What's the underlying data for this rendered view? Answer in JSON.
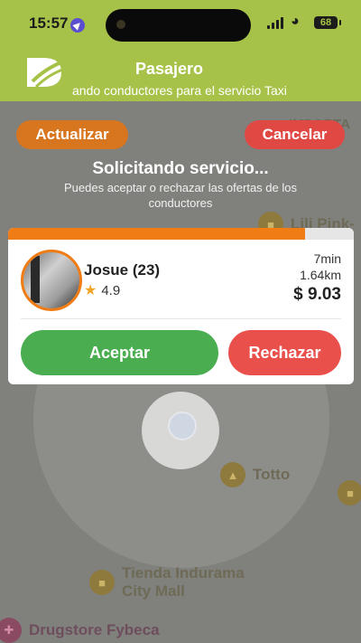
{
  "status_bar": {
    "time": "15:57",
    "battery": "68"
  },
  "header": {
    "title": "Pasajero",
    "subtitle": "ando conductores para el servicio Taxi"
  },
  "actions": {
    "update_label": "Actualizar",
    "cancel_label": "Cancelar"
  },
  "request": {
    "title": "Solicitando servicio...",
    "subtitle": "Puedes aceptar o rechazar las ofertas de los conductores"
  },
  "offer": {
    "driver_name": "Josue (23)",
    "rating": "4.9",
    "eta": "7min",
    "distance": "1.64km",
    "price": "$ 9.03",
    "accept_label": "Aceptar",
    "reject_label": "Rechazar",
    "time_remaining_fraction": 0.86
  },
  "map": {
    "pois": [
      {
        "name": "Lili Pink-",
        "icon": "shopping-icon"
      },
      {
        "name": "Totto",
        "icon": "clothing-icon"
      },
      {
        "name": "Tienda Indurama\nCity Mall",
        "icon": "shop-icon"
      },
      {
        "name": "Drugstore Fybeca",
        "icon": "pharmacy-icon"
      }
    ],
    "edge_label": "IMPORTA\nA G"
  },
  "colors": {
    "brand": "#a7c248",
    "orange": "#ef7c14",
    "accept": "#4aae50",
    "reject": "#e9504b"
  }
}
